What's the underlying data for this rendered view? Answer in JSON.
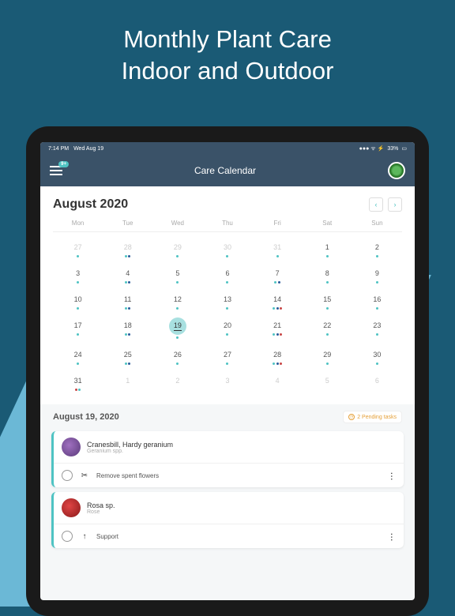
{
  "marketing": {
    "line1": "Monthly Plant Care",
    "line2": "Indoor and Outdoor"
  },
  "status": {
    "time": "7:14 PM",
    "date": "Wed Aug 19",
    "battery": "33%"
  },
  "header": {
    "title": "Care Calendar",
    "badge": "9+"
  },
  "calendar": {
    "month_title": "August 2020",
    "weekdays": [
      "Mon",
      "Tue",
      "Wed",
      "Thu",
      "Fri",
      "Sat",
      "Sun"
    ],
    "selected_day": 19,
    "days": [
      {
        "n": 27,
        "muted": true,
        "dots": [
          "teal"
        ]
      },
      {
        "n": 28,
        "muted": true,
        "dots": [
          "teal",
          "blue"
        ]
      },
      {
        "n": 29,
        "muted": true,
        "dots": [
          "teal"
        ]
      },
      {
        "n": 30,
        "muted": true,
        "dots": [
          "teal"
        ]
      },
      {
        "n": 31,
        "muted": true,
        "dots": [
          "teal"
        ]
      },
      {
        "n": 1,
        "dots": [
          "teal"
        ]
      },
      {
        "n": 2,
        "dots": [
          "teal"
        ]
      },
      {
        "n": 3,
        "dots": [
          "teal"
        ]
      },
      {
        "n": 4,
        "dots": [
          "teal",
          "blue"
        ]
      },
      {
        "n": 5,
        "dots": [
          "teal"
        ]
      },
      {
        "n": 6,
        "dots": [
          "teal"
        ]
      },
      {
        "n": 7,
        "dots": [
          "teal",
          "blue"
        ]
      },
      {
        "n": 8,
        "dots": [
          "teal"
        ]
      },
      {
        "n": 9,
        "dots": [
          "teal"
        ]
      },
      {
        "n": 10,
        "dots": [
          "teal"
        ]
      },
      {
        "n": 11,
        "dots": [
          "teal",
          "blue"
        ]
      },
      {
        "n": 12,
        "dots": [
          "teal"
        ]
      },
      {
        "n": 13,
        "dots": [
          "teal"
        ]
      },
      {
        "n": 14,
        "dots": [
          "teal",
          "blue",
          "red"
        ]
      },
      {
        "n": 15,
        "dots": [
          "teal"
        ]
      },
      {
        "n": 16,
        "dots": [
          "teal"
        ]
      },
      {
        "n": 17,
        "dots": [
          "teal"
        ]
      },
      {
        "n": 18,
        "dots": [
          "teal",
          "blue"
        ]
      },
      {
        "n": 19,
        "dots": [
          "teal"
        ],
        "selected": true
      },
      {
        "n": 20,
        "dots": [
          "teal"
        ]
      },
      {
        "n": 21,
        "dots": [
          "teal",
          "blue",
          "red"
        ]
      },
      {
        "n": 22,
        "dots": [
          "teal"
        ]
      },
      {
        "n": 23,
        "dots": [
          "teal"
        ]
      },
      {
        "n": 24,
        "dots": [
          "teal"
        ]
      },
      {
        "n": 25,
        "dots": [
          "teal",
          "blue"
        ]
      },
      {
        "n": 26,
        "dots": [
          "teal"
        ]
      },
      {
        "n": 27,
        "dots": [
          "teal"
        ]
      },
      {
        "n": 28,
        "dots": [
          "teal",
          "blue",
          "red"
        ]
      },
      {
        "n": 29,
        "dots": [
          "teal"
        ]
      },
      {
        "n": 30,
        "dots": [
          "teal"
        ]
      },
      {
        "n": 31,
        "dots": [
          "red",
          "teal"
        ]
      },
      {
        "n": 1,
        "muted": true,
        "dots": []
      },
      {
        "n": 2,
        "muted": true,
        "dots": []
      },
      {
        "n": 3,
        "muted": true,
        "dots": []
      },
      {
        "n": 4,
        "muted": true,
        "dots": []
      },
      {
        "n": 5,
        "muted": true,
        "dots": []
      },
      {
        "n": 6,
        "muted": true,
        "dots": []
      }
    ]
  },
  "selected_date": {
    "label": "August 19, 2020",
    "pending_text": "2 Pending tasks"
  },
  "tasks": [
    {
      "plant_common": "Cranesbill, Hardy geranium",
      "plant_latin": "Geranium spp.",
      "img": "purple",
      "action_icon": "scissors",
      "action_label": "Remove spent flowers"
    },
    {
      "plant_common": "Rosa sp.",
      "plant_latin": "Rose",
      "img": "red",
      "action_icon": "arrow",
      "action_label": "Support"
    }
  ]
}
